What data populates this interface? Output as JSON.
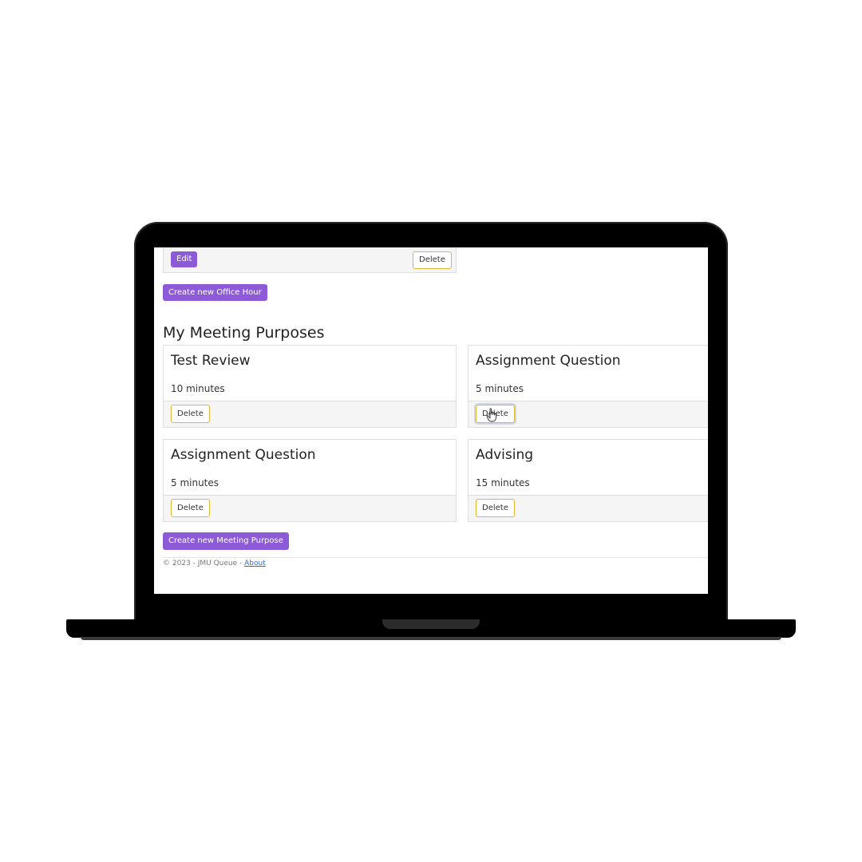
{
  "office_hour_card": {
    "edit_label": "Edit",
    "delete_label": "Delete"
  },
  "create_office_hour_label": "Create new Office Hour",
  "section_title": "My Meeting Purposes",
  "purposes": [
    {
      "title": "Test Review",
      "duration": "10 minutes",
      "delete_label": "Delete"
    },
    {
      "title": "Assignment Question",
      "duration": "5 minutes",
      "delete_label": "Delete"
    },
    {
      "title": "Assignment Question",
      "duration": "5 minutes",
      "delete_label": "Delete"
    },
    {
      "title": "Advising",
      "duration": "15 minutes",
      "delete_label": "Delete"
    }
  ],
  "create_purpose_label": "Create new Meeting Purpose",
  "footer": {
    "copyright": "© 2023 - JMU Queue - ",
    "about_link": "About"
  },
  "colors": {
    "accent": "#8e5bd8",
    "warning_outline": "#e2b534",
    "link": "#2b6fd6"
  }
}
